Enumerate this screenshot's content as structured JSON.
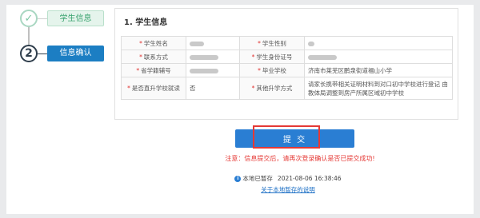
{
  "stepper": {
    "step1": {
      "icon": "✓",
      "label": "学生信息"
    },
    "step2": {
      "number": "2",
      "label": "信息确认"
    }
  },
  "card": {
    "title": "1. 学生信息",
    "rows": [
      {
        "l1": "学生姓名",
        "v1": "",
        "l2": "学生性别",
        "v2": ""
      },
      {
        "l1": "联系方式",
        "v1": "",
        "l2": "学生身份证号",
        "v2": ""
      },
      {
        "l1": "省学籍辅号",
        "v1": "",
        "l2": "毕业学校",
        "v2": "济南市莱芜区鹏泉街道福山小学"
      },
      {
        "l1": "是否直升学校就读",
        "v1": "否",
        "l2": "其他升学方式",
        "v2": "请家长携带相关证明材料到对口初中学校进行登记 由教体局调整到房产所属区域初中学校"
      }
    ]
  },
  "submit_label": "提 交",
  "notice": "注意：信息提交后，请再次登录确认是否已提交成功!",
  "saved": {
    "icon": "i",
    "text": "本地已暂存",
    "time": "2021-08-06 16:38:46"
  },
  "link_text": "关于本地暂存的说明"
}
